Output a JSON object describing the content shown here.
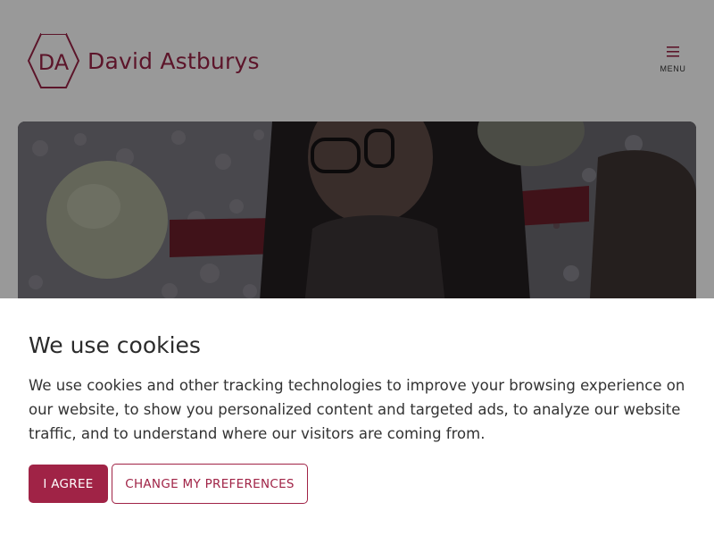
{
  "header": {
    "logo_monogram": "DA",
    "brand_name": "David Astburys",
    "menu_label": "MENU",
    "menu_icon": "hamburger-icon"
  },
  "hero": {
    "image": "video-still-person-with-glasses-and-balloons"
  },
  "cookie_banner": {
    "title": "We use cookies",
    "body": "We use cookies and other tracking technologies to improve your browsing experience on our website, to show you personalized content and targeted ads, to analyze our website traffic, and to understand where our visitors are coming from.",
    "agree_label": "I AGREE",
    "preferences_label": "CHANGE MY PREFERENCES"
  },
  "colors": {
    "brand": "#a02346",
    "overlay": "rgba(0,0,0,0.40)",
    "text": "#333333"
  }
}
